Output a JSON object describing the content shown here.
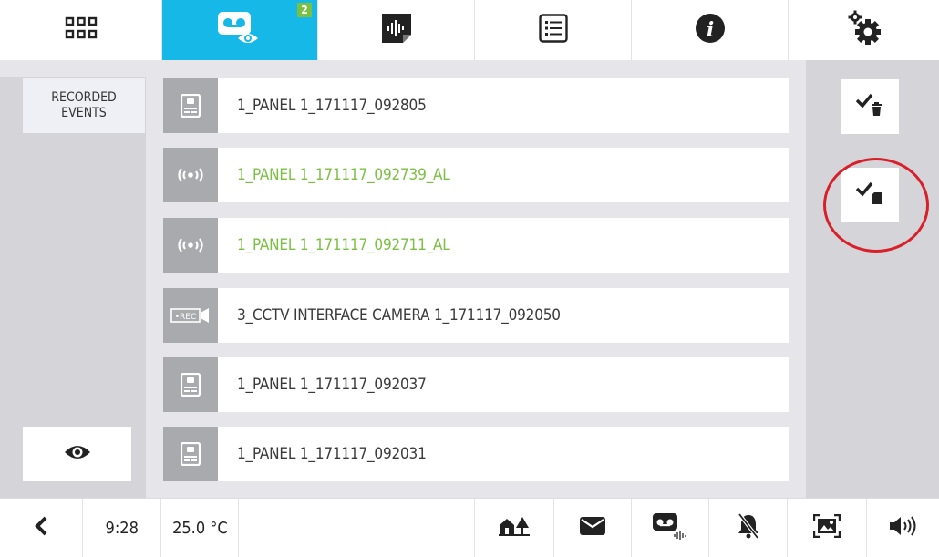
{
  "topbar": {
    "tabs": [
      {
        "name": "apps",
        "icon": "grid-icon"
      },
      {
        "name": "recorded-events",
        "icon": "voicemail-eye-icon",
        "active": true,
        "badge": "2"
      },
      {
        "name": "audio-messages",
        "icon": "audio-file-icon"
      },
      {
        "name": "list",
        "icon": "list-icon"
      },
      {
        "name": "info",
        "icon": "info-icon"
      },
      {
        "name": "settings",
        "icon": "gears-icon"
      }
    ]
  },
  "sidebar": {
    "category_label": "RECORDED\nEVENTS",
    "view_icon": "eye-icon"
  },
  "events": [
    {
      "label": "1_PANEL 1_171117_092805",
      "type": "panel",
      "icon": "door-panel-icon"
    },
    {
      "label": "1_PANEL 1_171117_092739_AL",
      "type": "alarm",
      "icon": "alarm-icon"
    },
    {
      "label": "1_PANEL 1_171117_092711_AL",
      "type": "alarm",
      "icon": "alarm-icon"
    },
    {
      "label": "3_CCTV INTERFACE CAMERA 1_171117_092050",
      "type": "cctv",
      "icon": "rec-camera-icon",
      "icon_text": "•REC"
    },
    {
      "label": "1_PANEL 1_171117_092037",
      "type": "panel",
      "icon": "door-panel-icon"
    },
    {
      "label": "1_PANEL 1_171117_092031",
      "type": "panel",
      "icon": "door-panel-icon"
    }
  ],
  "actions": [
    {
      "name": "select-delete",
      "icon": "check-trash-icon"
    },
    {
      "name": "select-save-sd",
      "icon": "check-sdcard-icon",
      "highlighted": true
    }
  ],
  "bottombar": {
    "back_icon": "chevron-left-icon",
    "time": "9:28",
    "temperature": "25.0 °C",
    "status_icons": [
      "home-tree-icon",
      "envelope-icon",
      "voicemail-icon",
      "bell-off-icon",
      "picture-icon",
      "speaker-icon"
    ]
  },
  "colors": {
    "accent": "#16b8e8",
    "alarm_text": "#7bc043",
    "highlight_ring": "#d8202a",
    "badge": "#7bc043"
  }
}
